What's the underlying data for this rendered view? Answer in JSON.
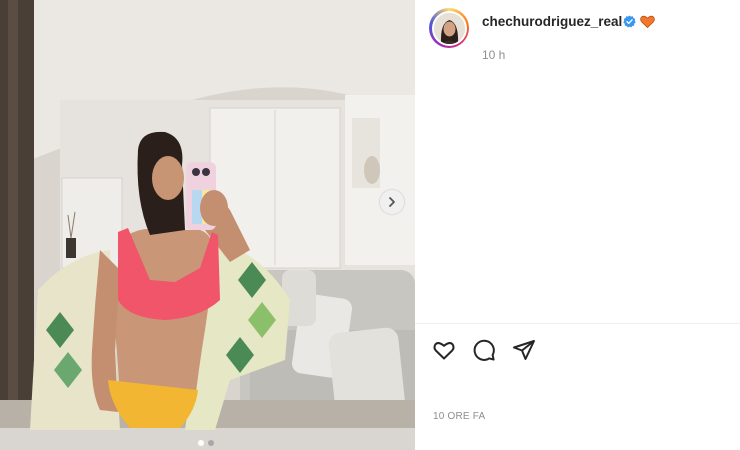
{
  "post": {
    "username": "chechurodriguez_real",
    "time_short": "10 h",
    "time_ago": "10 ORE FA"
  },
  "media": {
    "description_icon": "mirror-selfie-photo",
    "carousel_count": 2,
    "carousel_active": 1
  },
  "icons": {
    "verified": "verified-badge-icon",
    "heart_emoji": "orange-heart-icon",
    "like": "heart-outline-icon",
    "comment": "comment-bubble-icon",
    "share": "paper-plane-icon",
    "next": "chevron-right-icon"
  },
  "colors": {
    "verified_blue": "#3897f0",
    "emoji_orange": "#f4762a",
    "text_primary": "#262626",
    "text_secondary": "#8e8e8e"
  }
}
